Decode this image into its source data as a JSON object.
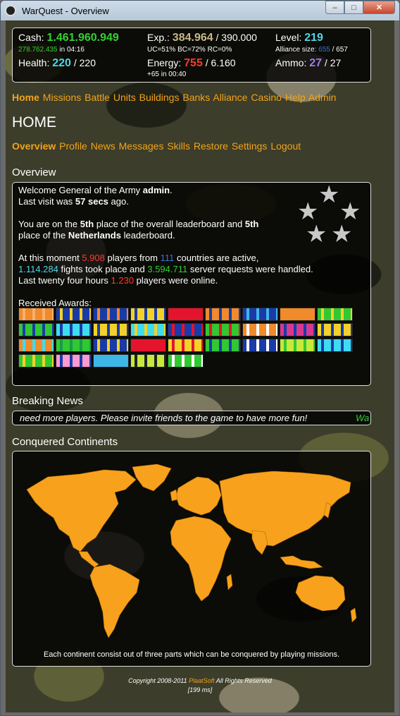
{
  "window": {
    "title": "WarQuest - Overview",
    "minimize": "–",
    "maximize": "□",
    "close": "✕"
  },
  "stats": {
    "cash_label": "Cash:",
    "cash_value": "1.461.960.949",
    "cash_rate": "278.762.435",
    "cash_in": "in 04:16",
    "exp_label": "Exp.:",
    "exp_value": "384.964",
    "exp_max": "/ 390.000",
    "exp_sub": "UC=51% BC=72% RC=0%",
    "level_label": "Level:",
    "level_value": "219",
    "alliance_label": "Alliance size:",
    "alliance_value": "655",
    "alliance_max": "/ 657",
    "health_label": "Health:",
    "health_value": "220",
    "health_max": "/ 220",
    "energy_label": "Energy:",
    "energy_value": "755",
    "energy_max": "/ 6.160",
    "energy_sub": "+65 in 00:40",
    "ammo_label": "Ammo:",
    "ammo_value": "27",
    "ammo_max": "/ 27"
  },
  "main_nav": [
    "Home",
    "Missions",
    "Battle",
    "Units",
    "Buildings",
    "Banks",
    "Alliance",
    "Casino",
    "Help",
    "Admin"
  ],
  "page_title": "HOME",
  "sub_nav": [
    "Overview",
    "Profile",
    "News",
    "Messages",
    "Skills",
    "Restore",
    "Settings",
    "Logout"
  ],
  "overview": {
    "section_title": "Overview",
    "welcome_prefix": "Welcome General of the Army ",
    "username": "admin",
    "welcome_suffix": ".",
    "last_visit_prefix": "Last visit was ",
    "last_visit_value": "57 secs",
    "last_visit_suffix": " ago.",
    "rank_line1_a": "You are on the ",
    "rank_overall": "5th",
    "rank_line1_b": " place of the overall leaderboard and ",
    "rank_country": "5th",
    "rank_line2_a": "place of the ",
    "country": "Netherlands",
    "rank_line2_b": " leaderboard.",
    "active_a": "At this moment ",
    "players_active": "5.908",
    "active_b": " players from ",
    "countries": "111",
    "active_c": " countries are active,",
    "fights": "1.114.284",
    "fights_b": " fights took place and ",
    "requests": "3.594.711",
    "requests_b": " server requests were handled.",
    "last24_a": "Last twenty four hours ",
    "online": "1.230",
    "last24_b": " players were online.",
    "awards_label": "Received Awards:",
    "rank_insignia_icon": "five-star-general-insignia"
  },
  "news": {
    "section_title": "Breaking News",
    "ticker": "need more players. Please invite friends to the game to have more fun!",
    "ticker_next": "Wa"
  },
  "continents": {
    "section_title": "Conquered Continents",
    "caption": "Each continent consist out of three parts which can be conquered by playing missions.",
    "map_color": "#f7a11d"
  },
  "footer": {
    "copyright_a": "Copyright 2008-2011 ",
    "company": "PlaatSoft",
    "copyright_b": " All Rights Reserved",
    "timing": "[199 ms]"
  },
  "colors": {
    "accent": "#f2a31a",
    "cash": "#32d032",
    "health": "#4fd6e8",
    "energy": "#ff3b2b",
    "ammo": "#a07cf0"
  }
}
